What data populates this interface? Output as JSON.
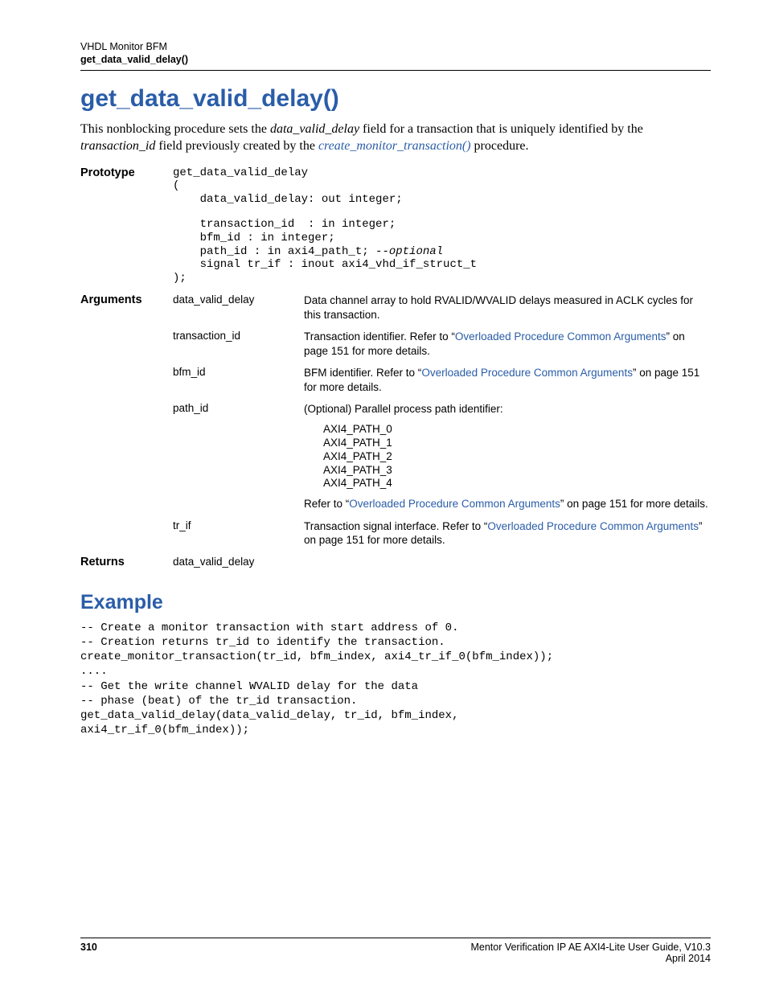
{
  "header": {
    "line1": "VHDL Monitor BFM",
    "line2": "get_data_valid_delay()"
  },
  "title": "get_data_valid_delay()",
  "intro": {
    "part1": "This nonblocking procedure sets the ",
    "ital1": "data_valid_delay",
    "part2": " field for a transaction that is uniquely identified by the ",
    "ital2": "transaction_id",
    "part3": " field previously created by the ",
    "link": "create_monitor_transaction()",
    "part4": " procedure."
  },
  "prototype": {
    "label": "Prototype",
    "code_l1": "get_data_valid_delay",
    "code_l2": "(",
    "code_l3": "    data_valid_delay: out integer;",
    "code_blank": "",
    "code_l4": "    transaction_id  : in integer;",
    "code_l5": "    bfm_id : in integer;",
    "code_l6a": "    path_id : in axi4_path_t; ",
    "code_l6b": "--optional",
    "code_l7": "    signal tr_if : inout axi4_vhd_if_struct_t",
    "code_l8": ");"
  },
  "arguments": {
    "label": "Arguments",
    "rows": {
      "dvd": {
        "name": "data_valid_delay",
        "desc": "Data channel array to hold RVALID/WVALID delays measured in ACLK cycles for this transaction."
      },
      "tid": {
        "name": "transaction_id",
        "desc_pre": "Transaction identifier. Refer to “",
        "link": "Overloaded Procedure Common Arguments",
        "desc_post": "” on page 151 for more details."
      },
      "bfm": {
        "name": "bfm_id",
        "desc_pre": "BFM identifier. Refer to “",
        "link": "Overloaded Procedure Common Arguments",
        "desc_post": "” on page 151 for more details."
      },
      "path": {
        "name": "path_id",
        "desc_top": "(Optional) Parallel process path identifier:",
        "list": {
          "p0": "AXI4_PATH_0",
          "p1": "AXI4_PATH_1",
          "p2": "AXI4_PATH_2",
          "p3": "AXI4_PATH_3",
          "p4": "AXI4_PATH_4"
        },
        "desc_bot_pre": "Refer to “",
        "desc_bot_link": "Overloaded Procedure Common Arguments",
        "desc_bot_post": "” on page 151 for more details."
      },
      "trif": {
        "name": "tr_if",
        "desc_pre": "Transaction signal interface. Refer to “",
        "link": "Overloaded Procedure Common Arguments",
        "desc_post": "” on page 151 for more details."
      }
    }
  },
  "returns": {
    "label": "Returns",
    "value": "data_valid_delay"
  },
  "example": {
    "title": "Example",
    "code": "-- Create a monitor transaction with start address of 0.\n-- Creation returns tr_id to identify the transaction.\ncreate_monitor_transaction(tr_id, bfm_index, axi4_tr_if_0(bfm_index));\n....\n-- Get the write channel WVALID delay for the data\n-- phase (beat) of the tr_id transaction.\nget_data_valid_delay(data_valid_delay, tr_id, bfm_index,\naxi4_tr_if_0(bfm_index));"
  },
  "footer": {
    "page": "310",
    "right1": "Mentor Verification IP AE AXI4-Lite User Guide, V10.3",
    "right2": "April 2014"
  }
}
